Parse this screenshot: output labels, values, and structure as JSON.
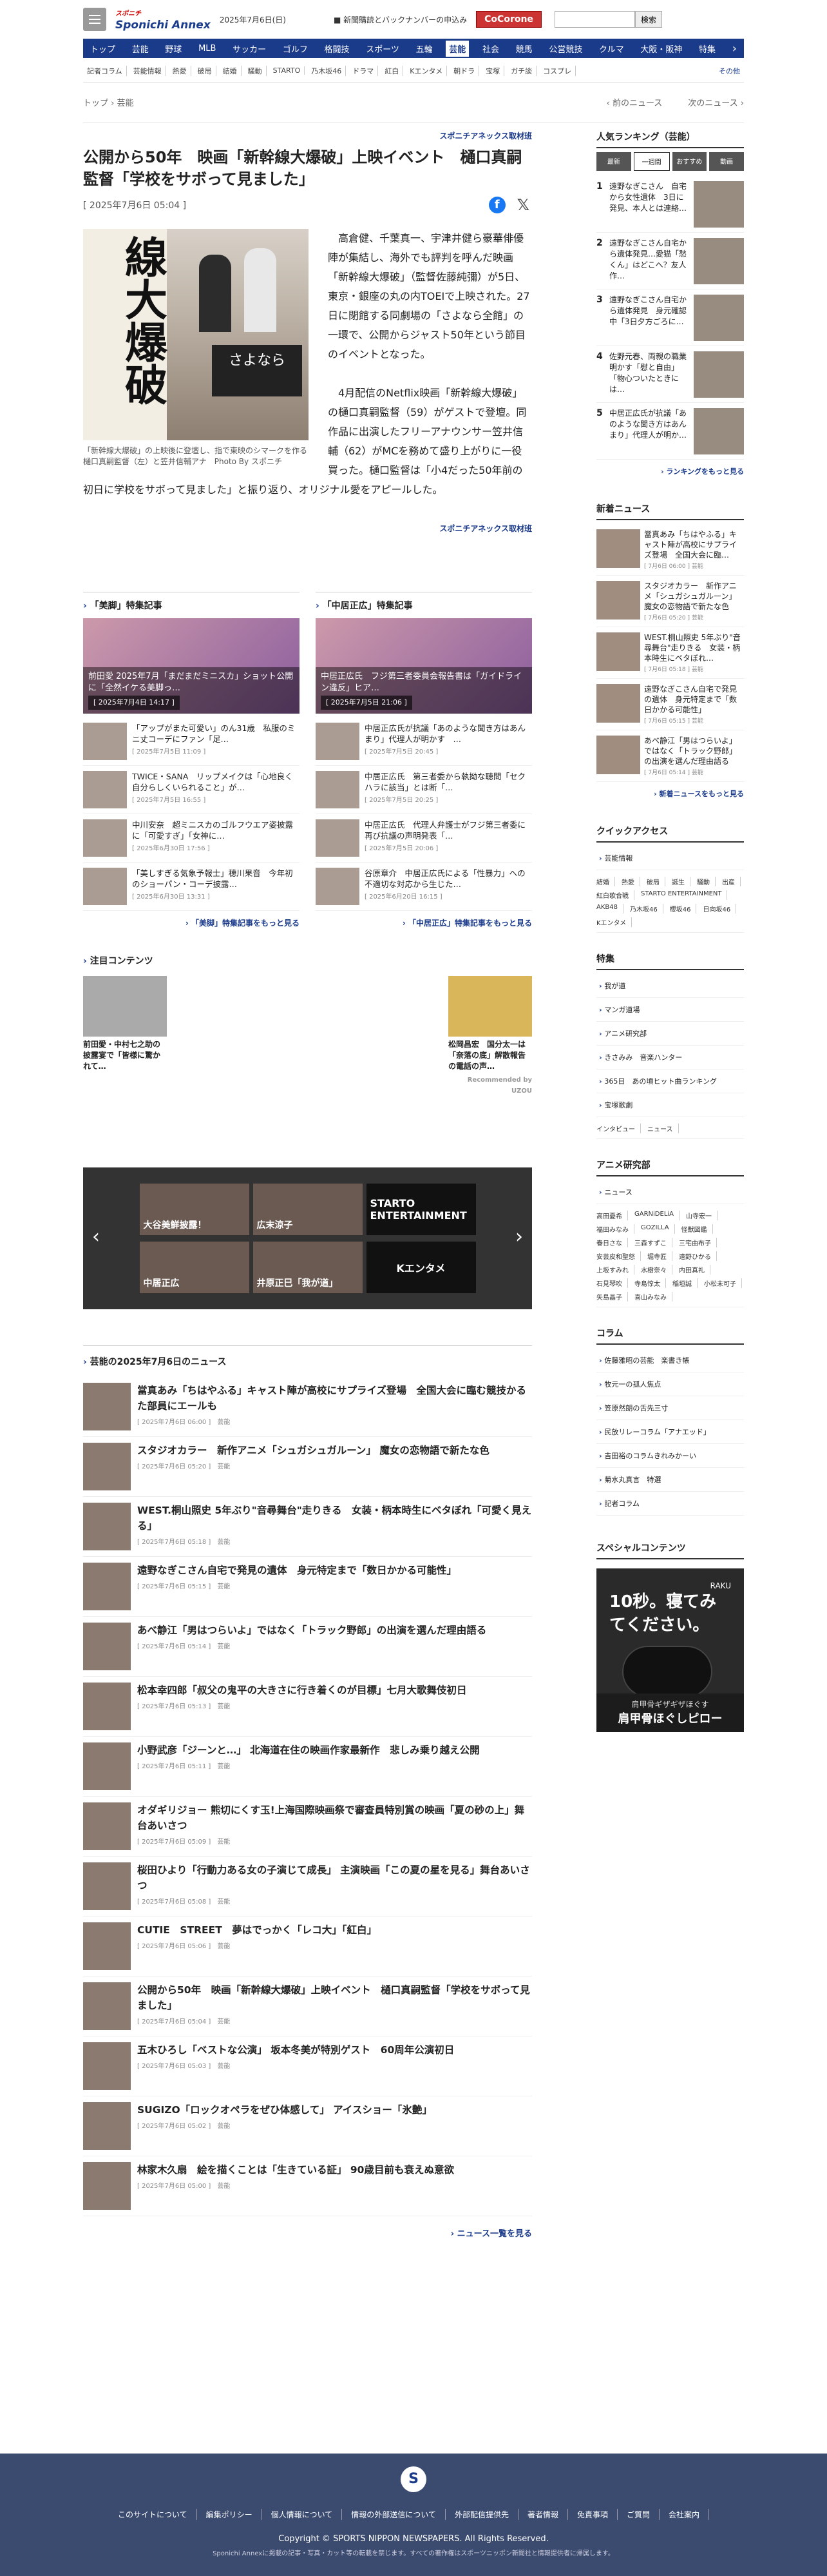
{
  "header": {
    "logo_top": "スポニチ",
    "logo_main": "Sponichi Annex",
    "date": "2025年7月6日(日)",
    "notice": "■ 新聞購読とバックナンバーの申込み",
    "cocorone": "CoCorone",
    "search_button": "検索"
  },
  "gnav": [
    "トップ",
    "芸能",
    "野球",
    "MLB",
    "サッカー",
    "ゴルフ",
    "格闘技",
    "スポーツ",
    "五輪",
    "芸能",
    "社会",
    "競馬",
    "公営競技",
    "クルマ",
    "大阪・阪神",
    "特集"
  ],
  "subnav": [
    "記者コラム",
    "芸能情報",
    "熱愛",
    "破局",
    "結婚",
    "騒動",
    "STARTO",
    "乃木坂46",
    "ドラマ",
    "紅白",
    "Kエンタメ",
    "朝ドラ",
    "宝塚",
    "ガチ談",
    "コスプレ"
  ],
  "subnav_more": "その他",
  "crumbs": {
    "top": "トップ",
    "cat": "芸能",
    "prev": "前のニュース",
    "next": "次のニュース"
  },
  "article": {
    "source": "スポニチアネックス取材班",
    "title": "公開から50年　映画「新幹線大爆破」上映イベント　樋口真嗣監督「学校をサボって見ました」",
    "date": "[ 2025年7月6日 05:04 ]",
    "photo_text": "線大爆破",
    "photo_sign": "さよなら",
    "caption": "「新幹線大爆破」の上映後に登壇し、指で東映のシマークを作る樋口真嗣監督（左）と笠井信輔アナ　Photo By スポニチ",
    "p1": "高倉健、千葉真一、宇津井健ら豪華俳優陣が集結し、海外でも評判を呼んだ映画「新幹線大爆破」（監督佐藤純彌）が5日、東京・銀座の丸の内TOEIで上映された。27日に閉館する同劇場の「さよなら全館」の一環で、公開からジャスト50年という節目のイベントとなった。",
    "p2": "4月配信のNetflix映画「新幹線大爆破」の樋口真嗣監督（59）がゲストで登壇。同作品に出演したフリーアナウンサー笠井信輔（62）がMCを務めて盛り上がりに一役買った。樋口監督は「小4だった50年前の初日に学校をサボって見ました」と振り返り、オリジナル愛をアピールした。"
  },
  "feat1": {
    "head": "「美脚」特集記事",
    "hero": "前田愛 2025年7月「まだまだミニスカ」ショット公開に「全然イケる美脚っ…",
    "hero_date": "[ 2025年7月4日 14:17 ]",
    "items": [
      {
        "t": "「アップがまた可愛い」のん31歳　私服のミニ丈コーデにファン「足…",
        "d": "[ 2025年7月5日 11:09 ]"
      },
      {
        "t": "TWICE・SANA　リップメイクは「心地良く自分らしくいられること」が…",
        "d": "[ 2025年7月5日 16:55 ]"
      },
      {
        "t": "中川安奈　超ミニスカのゴルフウエア姿披露に「可愛すぎ」「女神に…",
        "d": "[ 2025年6月30日 17:56 ]"
      },
      {
        "t": "「美しすぎる気象予報士」穂川果音　今年初のショーパン・コーデ披露…",
        "d": "[ 2025年6月30日 13:31 ]"
      }
    ],
    "more": "「美脚」特集記事をもっと見る"
  },
  "feat2": {
    "head": "「中居正広」特集記事",
    "hero": "中居正広氏　フジ第三者委員会報告書は「ガイドライン違反」ヒア…",
    "hero_date": "[ 2025年7月5日 21:06 ]",
    "items": [
      {
        "t": "中居正広氏が抗議「あのような聞き方はあんまり」代理人が明かす　…",
        "d": "[ 2025年7月5日 20:45 ]"
      },
      {
        "t": "中居正広氏　第三者委から執拗な聴問「セクハラに該当」とは断「…",
        "d": "[ 2025年7月5日 20:25 ]"
      },
      {
        "t": "中居正広氏　代理人弁護士がフジ第三者委に再び抗議の声明発表「…",
        "d": "[ 2025年7月5日 20:06 ]"
      },
      {
        "t": "谷原章介　中居正広氏による「性暴力」への不適切な対応から生じた…",
        "d": "[ 2025年6月20日 16:15 ]"
      }
    ],
    "more": "「中居正広」特集記事をもっと見る"
  },
  "attn": {
    "head": "注目コンテンツ",
    "c1": "前田愛・中村七之助の披露宴で「皆様に驚かれて…",
    "c2": "松岡昌宏　国分太一は「奈落の底」解散報告の電話の声…",
    "rec": "Recommended by UZOU"
  },
  "carousel": [
    "大谷美鮮披露！",
    "広末涼子",
    "STARTO ENTERTAINMENT",
    "中居正広",
    "井原正巳「我が道」",
    "Kエンタメ"
  ],
  "news": {
    "head": "芸能の2025年7月6日のニュース",
    "more": "ニュース一覧を見る",
    "items": [
      {
        "t": "當真あみ「ちはやふる」キャスト陣が高校にサプライズ登場　全国大会に臨む競技かるた部員にエールも",
        "d": "[ 2025年7月6日 06:00 ]　芸能"
      },
      {
        "t": "スタジオカラー　新作アニメ「シュガシュガルーン」 魔女の恋物語で新たな色",
        "d": "[ 2025年7月6日 05:20 ]　芸能"
      },
      {
        "t": "WEST.桐山照史 5年ぶり\"音尋舞台\"走りきる　女装・柄本時生にベタぼれ「可愛く見える」",
        "d": "[ 2025年7月6日 05:18 ]　芸能"
      },
      {
        "t": "遠野なぎこさん自宅で発見の遺体　身元特定まで「数日かかる可能性」",
        "d": "[ 2025年7月6日 05:15 ]　芸能"
      },
      {
        "t": "あべ静江「男はつらいよ」ではなく「トラック野郎」の出演を選んだ理由語る",
        "d": "[ 2025年7月6日 05:14 ]　芸能"
      },
      {
        "t": "松本幸四郎「叔父の鬼平の大きさに行き着くのが目標」七月大歌舞伎初日",
        "d": "[ 2025年7月6日 05:13 ]　芸能"
      },
      {
        "t": "小野武彦「ジーンと…」 北海道在住の映画作家最新作　悲しみ乗り越え公開",
        "d": "[ 2025年7月6日 05:11 ]　芸能"
      },
      {
        "t": "オダギリジョー 熊切にくす玉!上海国際映画祭で審査員特別賞の映画「夏の砂の上」舞台あいさつ",
        "d": "[ 2025年7月6日 05:09 ]　芸能"
      },
      {
        "t": "桜田ひより「行動力ある女の子演じて成長」 主演映画「この夏の星を見る」舞台あいさつ",
        "d": "[ 2025年7月6日 05:08 ]　芸能"
      },
      {
        "t": "CUTIE　STREET　夢はでっかく「レコ大」「紅白」",
        "d": "[ 2025年7月6日 05:06 ]　芸能"
      },
      {
        "t": "公開から50年　映画「新幹線大爆破」上映イベント　樋口真嗣監督「学校をサボって見ました」",
        "d": "[ 2025年7月6日 05:04 ]　芸能"
      },
      {
        "t": "五木ひろし「ベストな公演」 坂本冬美が特別ゲスト　60周年公演初日",
        "d": "[ 2025年7月6日 05:03 ]　芸能"
      },
      {
        "t": "SUGIZO「ロックオペラをぜひ体感して」 アイスショー「氷艶」",
        "d": "[ 2025年7月6日 05:02 ]　芸能"
      },
      {
        "t": "林家木久扇　絵を描くことは「生きている証」 90歳目前も衰えぬ意欲",
        "d": "[ 2025年7月6日 05:00 ]　芸能"
      }
    ]
  },
  "ranking": {
    "head": "人気ランキング（芸能）",
    "tabs": [
      "最新",
      "一週間",
      "おすすめ",
      "動画"
    ],
    "more": "ランキングをもっと見る",
    "items": [
      {
        "n": "1",
        "t": "遠野なぎこさん　自宅から女性遺体　3日に発見、本人とは連絡…"
      },
      {
        "n": "2",
        "t": "遠野なぎこさん自宅から遺体発見…愛猫「愁くん」はどこへ？友人作…"
      },
      {
        "n": "3",
        "t": "遠野なぎこさん自宅から遺体発見　身元確認中「3日夕方ごろに…"
      },
      {
        "n": "4",
        "t": "佐野元春、両親の職業明かす「慰と自由」「物心ついたときには…"
      },
      {
        "n": "5",
        "t": "中居正広氏が抗議「あのような聞き方はあんまり」代理人が明か…"
      }
    ]
  },
  "latest": {
    "head": "新着ニュース",
    "more": "新着ニュースをもっと見る",
    "items": [
      {
        "t": "當真あみ「ちはやふる」キャスト陣が高校にサプライズ登場　全国大会に臨…",
        "d": "[ 7月6日 06:00 ] 芸能"
      },
      {
        "t": "スタジオカラー　新作アニメ「シュガシュガルーン」 魔女の恋物語で新たな色",
        "d": "[ 7月6日 05:20 ] 芸能"
      },
      {
        "t": "WEST.桐山照史 5年ぶり\"音尋舞台\"走りきる　女装・柄本時生にベタぼれ…",
        "d": "[ 7月6日 05:18 ] 芸能"
      },
      {
        "t": "遠野なぎこさん自宅で発見の遺体　身元特定まで「数日かかる可能性」",
        "d": "[ 7月6日 05:15 ] 芸能"
      },
      {
        "t": "あべ静江「男はつらいよ」ではなく「トラック野郎」の出演を選んだ理由語る",
        "d": "[ 7月6日 05:14 ] 芸能"
      }
    ]
  },
  "quick": {
    "head": "クイックアクセス",
    "sub": "芸能情報",
    "tags": [
      "結婚",
      "熱愛",
      "破局",
      "誕生",
      "騒動",
      "出産",
      "紅白歌合戦",
      "STARTO ENTERTAINMENT",
      "AKB48",
      "乃木坂46",
      "櫻坂46",
      "日向坂46",
      "Kエンタメ"
    ]
  },
  "special": {
    "head": "特集",
    "items": [
      "我が道",
      "マンガ道場",
      "アニメ研究部",
      "きさみみ　音楽ハンター",
      "365日　あの頃ヒット曲ランキング",
      "宝塚歌劇"
    ],
    "tags": [
      "インタビュー",
      "ニュース"
    ]
  },
  "anime": {
    "head": "アニメ研究部",
    "sub": "ニュース",
    "tags": [
      "高田憂希",
      "GARNiDELiA",
      "山寺宏一",
      "福田みなみ",
      "GOZILLA",
      "怪獣図鑑",
      "春日さな",
      "三森すずこ",
      "三宅由布子",
      "安芸皮和聖怒",
      "堀寺匠",
      "遠野ひかる",
      "上坂すみれ",
      "水樹奈々",
      "内田真礼",
      "石見琴吹",
      "寺島惇太",
      "稲垣誠",
      "小松未可子",
      "矢島晶子",
      "喜山みなみ"
    ]
  },
  "column": {
    "head": "コラム",
    "items": [
      "佐藤雅昭の芸能　楽書き帳",
      "牧元一の孤人焦点",
      "笠原然朗の舌先三寸",
      "民放リレーコラム「アナエッド」",
      "吉田裕のコラムきれみかーい",
      "菊水丸真言　特選",
      "記者コラム"
    ]
  },
  "spcontent": {
    "head": "スペシャルコンテンツ",
    "ad_big": "10秒。寝てみてください。",
    "ad_brand": "RAKU",
    "ad_sub": "肩甲骨ギザギザほぐす",
    "ad_prod": "肩甲骨ほぐしピロー"
  },
  "footer": {
    "logo": "S",
    "links": [
      "このサイトについて",
      "編集ポリシー",
      "個人情報について",
      "情報の外部送信について",
      "外部配信提供先",
      "著者情報",
      "免責事項",
      "ご質問",
      "会社案内"
    ],
    "copyright": "Copyright © SPORTS NIPPON NEWSPAPERS. All Rights Reserved.",
    "note": "Sponichi Annexに掲載の記事・写真・カット等の転載を禁じます。すべての著作権はスポーツニッポン新聞社と情報提供者に帰属します。"
  }
}
